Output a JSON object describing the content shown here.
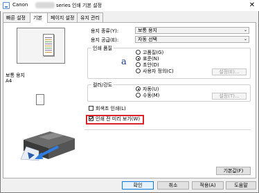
{
  "window": {
    "title_prefix": "Canon",
    "title_suffix": "series 인쇄 기본 설정",
    "close_glyph": "✕"
  },
  "tabs": [
    {
      "label": "빠른 설정"
    },
    {
      "label": "기본"
    },
    {
      "label": "페이지 설정"
    },
    {
      "label": "유지 관리"
    }
  ],
  "preview": {
    "media_label": "보통 용지",
    "size_label": "A4"
  },
  "settings": {
    "media_type": {
      "label": "용지 종류(Y):",
      "value": "보통 용지"
    },
    "paper_source": {
      "label": "용지 공급(E):",
      "value": "자동 선택"
    },
    "print_quality": {
      "group_title": "인쇄 품질",
      "icon_glyph": "a",
      "options": [
        {
          "label": "고품질(G)",
          "selected": false
        },
        {
          "label": "표준(N)",
          "selected": true
        },
        {
          "label": "초안(D)",
          "selected": false
        },
        {
          "label": "사용자 정의(C)",
          "selected": false
        }
      ],
      "set_button": "설정(E)..."
    },
    "color_intensity": {
      "group_title": "컬러/강도",
      "options": [
        {
          "label": "자동(U)",
          "selected": true
        },
        {
          "label": "수동(M)",
          "selected": false
        }
      ],
      "set_button": "설정(T)..."
    },
    "grayscale": {
      "label": "회색조 인쇄(L)",
      "checked": false
    },
    "preview_before_print": {
      "label": "인쇄 전 미리 보기(W)",
      "checked": true
    }
  },
  "buttons": {
    "defaults": "기본값(F)",
    "ok": "확인",
    "cancel": "취소",
    "apply": "적용(A)",
    "help": "도움말"
  },
  "colors": {
    "highlight": "#d9232a",
    "title_icon": "#5a8acb"
  }
}
